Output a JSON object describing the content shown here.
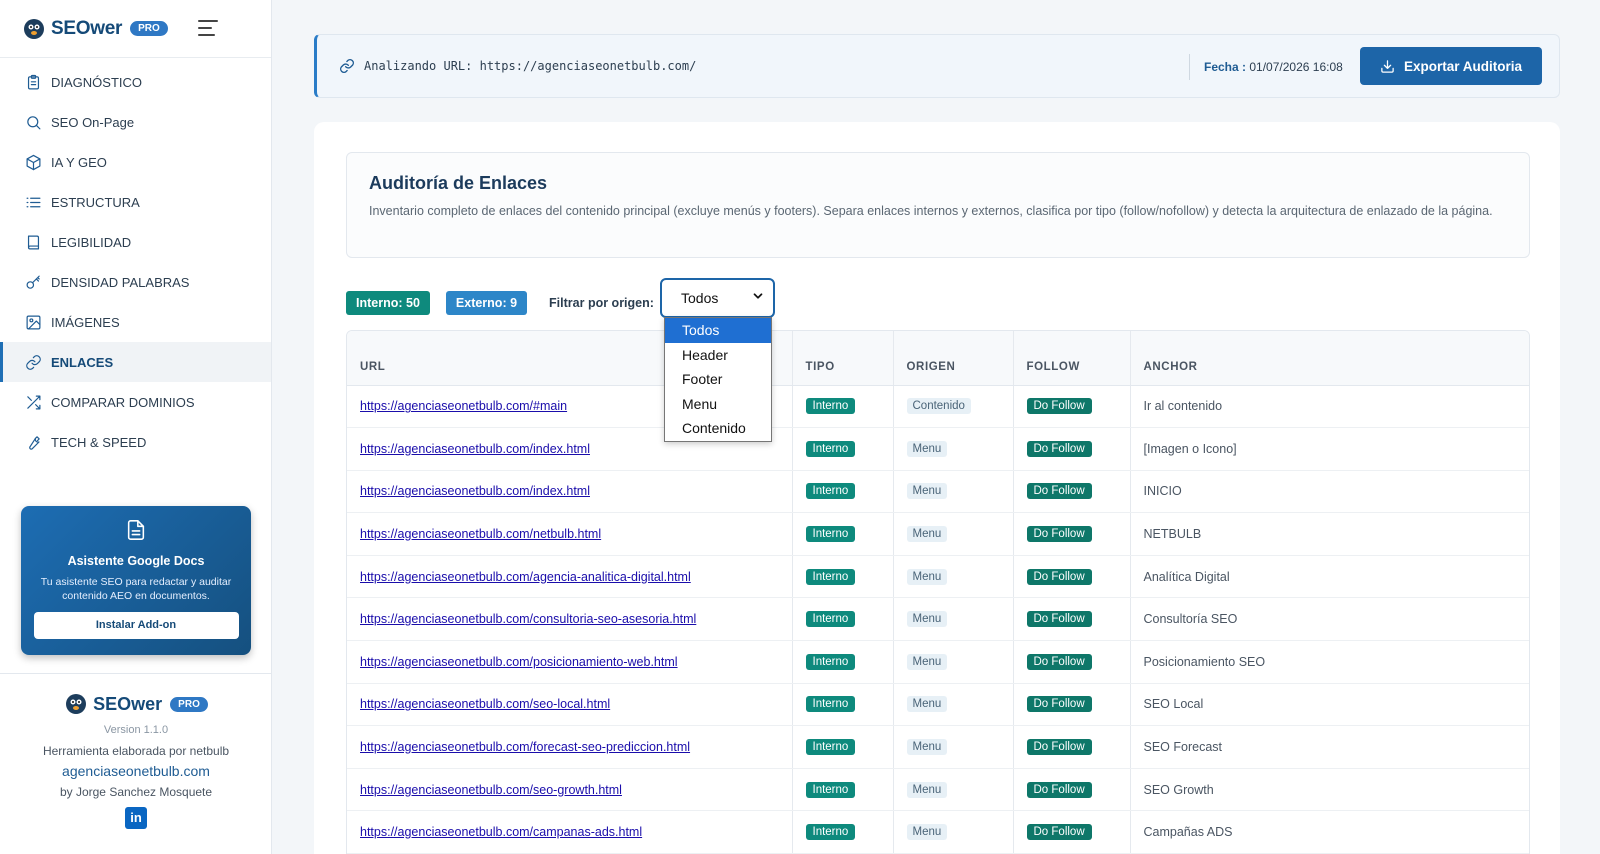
{
  "brand": {
    "name": "SEOwer",
    "badge": "PRO"
  },
  "nav": [
    {
      "label": "DIAGNÓSTICO",
      "icon": "clipboard-icon"
    },
    {
      "label": "SEO On-Page",
      "icon": "search-icon"
    },
    {
      "label": "IA Y GEO",
      "icon": "cube-icon"
    },
    {
      "label": "ESTRUCTURA",
      "icon": "list-icon"
    },
    {
      "label": "LEGIBILIDAD",
      "icon": "book-icon"
    },
    {
      "label": "DENSIDAD PALABRAS",
      "icon": "key-icon"
    },
    {
      "label": "IMÁGENES",
      "icon": "image-icon"
    },
    {
      "label": "ENLACES",
      "icon": "link-icon",
      "active": true
    },
    {
      "label": "COMPARAR DOMINIOS",
      "icon": "shuffle-icon"
    },
    {
      "label": "TECH & SPEED",
      "icon": "wrench-icon"
    }
  ],
  "promo": {
    "title": "Asistente Google Docs",
    "description": "Tu asistente SEO para redactar y auditar contenido AEO en documentos.",
    "button": "Instalar Add-on"
  },
  "footer": {
    "name": "SEOwer",
    "badge": "PRO",
    "version": "Version 1.1.0",
    "made_by": "Herramienta elaborada por netbulb",
    "site": "agenciaseonetbulb.com",
    "author": "by Jorge Sanchez Mosquete",
    "social": "in"
  },
  "topbar": {
    "analyzing": "Analizando URL: https://agenciaseonetbulb.com/",
    "fecha_label": "Fecha",
    "fecha_sep": ":",
    "fecha_value": "01/07/2026 16:08",
    "export_button": "Exportar Auditoria"
  },
  "section": {
    "title": "Auditoría de Enlaces",
    "description": "Inventario completo de enlaces del contenido principal (excluye menús y footers). Separa enlaces internos y externos, clasifica por tipo (follow/nofollow) y detecta la arquitectura de enlazado de la página."
  },
  "filters": {
    "internal": "Interno: 50",
    "external": "Externo: 9",
    "label": "Filtrar por origen:",
    "selected": "Todos",
    "options": [
      "Todos",
      "Header",
      "Footer",
      "Menu",
      "Contenido"
    ]
  },
  "table": {
    "headers": [
      "URL",
      "TIPO",
      "ORIGEN",
      "FOLLOW",
      "ANCHOR"
    ],
    "rows": [
      {
        "url": "https://agenciaseonetbulb.com/#main",
        "tipo": "Interno",
        "origen": "Contenido",
        "follow": "Do Follow",
        "anchor": "Ir al contenido"
      },
      {
        "url": "https://agenciaseonetbulb.com/index.html",
        "tipo": "Interno",
        "origen": "Menu",
        "follow": "Do Follow",
        "anchor": "[Imagen o Icono]"
      },
      {
        "url": "https://agenciaseonetbulb.com/index.html",
        "tipo": "Interno",
        "origen": "Menu",
        "follow": "Do Follow",
        "anchor": "INICIO"
      },
      {
        "url": "https://agenciaseonetbulb.com/netbulb.html",
        "tipo": "Interno",
        "origen": "Menu",
        "follow": "Do Follow",
        "anchor": "NETBULB"
      },
      {
        "url": "https://agenciaseonetbulb.com/agencia-analitica-digital.html",
        "tipo": "Interno",
        "origen": "Menu",
        "follow": "Do Follow",
        "anchor": "Analítica Digital"
      },
      {
        "url": "https://agenciaseonetbulb.com/consultoria-seo-asesoria.html",
        "tipo": "Interno",
        "origen": "Menu",
        "follow": "Do Follow",
        "anchor": "Consultoría SEO"
      },
      {
        "url": "https://agenciaseonetbulb.com/posicionamiento-web.html",
        "tipo": "Interno",
        "origen": "Menu",
        "follow": "Do Follow",
        "anchor": "Posicionamiento SEO"
      },
      {
        "url": "https://agenciaseonetbulb.com/seo-local.html",
        "tipo": "Interno",
        "origen": "Menu",
        "follow": "Do Follow",
        "anchor": "SEO Local"
      },
      {
        "url": "https://agenciaseonetbulb.com/forecast-seo-prediccion.html",
        "tipo": "Interno",
        "origen": "Menu",
        "follow": "Do Follow",
        "anchor": "SEO Forecast"
      },
      {
        "url": "https://agenciaseonetbulb.com/seo-growth.html",
        "tipo": "Interno",
        "origen": "Menu",
        "follow": "Do Follow",
        "anchor": "SEO Growth"
      },
      {
        "url": "https://agenciaseonetbulb.com/campanas-ads.html",
        "tipo": "Interno",
        "origen": "Menu",
        "follow": "Do Follow",
        "anchor": "Campañas ADS"
      }
    ]
  },
  "colors": {
    "accent": "#1d65a8",
    "internal": "#0e8a7d",
    "external": "#2d86c8"
  }
}
